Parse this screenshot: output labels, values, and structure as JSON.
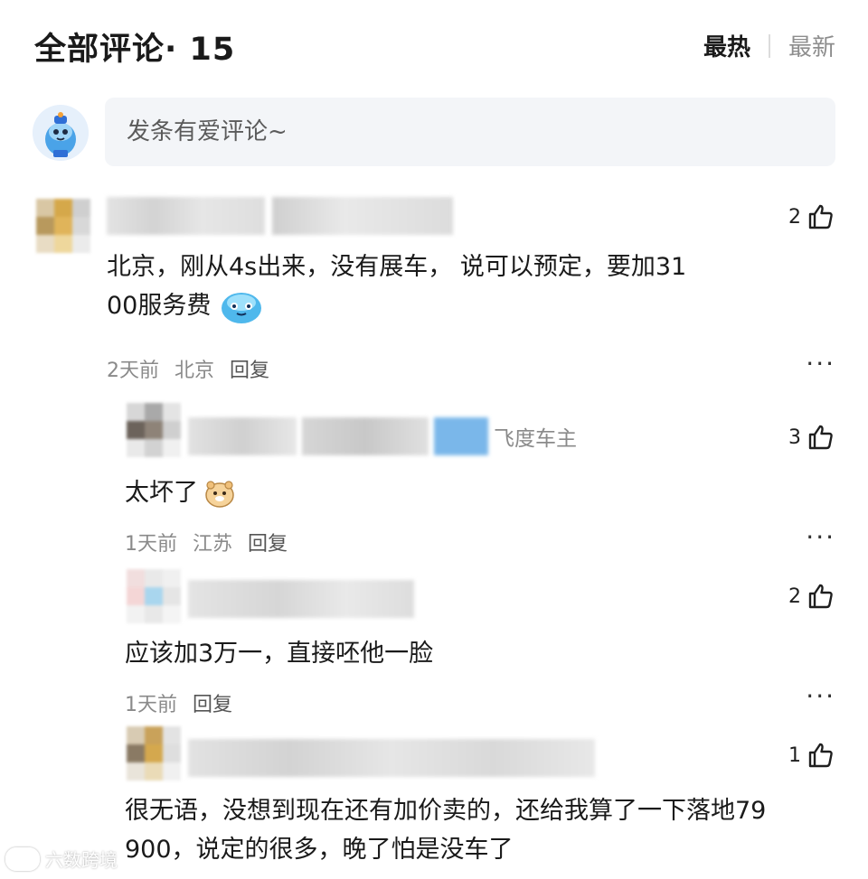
{
  "header": {
    "title": "全部评论· 15",
    "sort_hot": "最热",
    "sort_new": "最新"
  },
  "composer": {
    "placeholder": "发条有爱评论~"
  },
  "comments": [
    {
      "likes": "2",
      "text_line1": "北京，刚从4s出来，没有展车， 说可以预定，要加31",
      "text_line2": "00服务费",
      "emoji": "blue-blob-emoji",
      "time": "2天前",
      "location": "北京",
      "reply": "回复",
      "more": "···"
    },
    {
      "likes": "3",
      "badge": "飞度车主",
      "text": "太坏了",
      "emoji": "hamster-emoji",
      "time": "1天前",
      "location": "江苏",
      "reply": "回复",
      "more": "···"
    },
    {
      "likes": "2",
      "text": "应该加3万一，直接呸他一脸",
      "time": "1天前",
      "reply": "回复",
      "more": "···"
    },
    {
      "likes": "1",
      "text_line1": "很无语，没想到现在还有加价卖的，还给我算了一下落地79",
      "text_line2": "900，说定的很多，晚了怕是没车了"
    }
  ],
  "watermark": {
    "text": "六数跨境"
  },
  "colors": {
    "text": "#1a1a1a",
    "muted": "#8a8a8a",
    "input_bg": "#f3f5f8"
  }
}
